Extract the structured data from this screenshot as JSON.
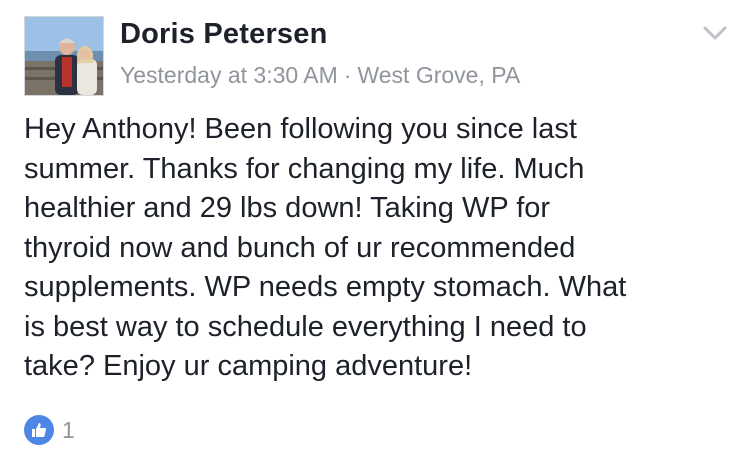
{
  "post": {
    "author": "Doris Petersen",
    "timestamp": "Yesterday at 3:30 AM",
    "separator": "·",
    "location": "West Grove, PA",
    "body": "Hey Anthony!  Been following you since last\nsummer. Thanks for changing my life.  Much\nhealthier and 29 lbs down!  Taking WP for\nthyroid now and bunch of ur recommended\nsupplements.  WP needs empty stomach. What\nis best way to schedule everything I need to\ntake?  Enjoy ur camping adventure!",
    "reactions": {
      "icon": "like-icon",
      "count": "1"
    }
  },
  "colors": {
    "text": "#1d2129",
    "meta": "#90949c",
    "like_blue": "#4e86e8"
  }
}
